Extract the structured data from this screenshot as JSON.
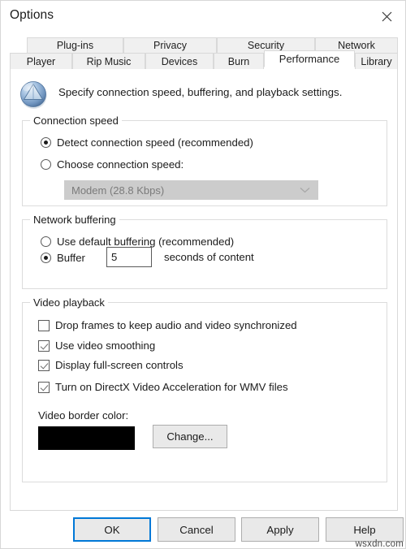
{
  "window": {
    "title": "Options",
    "close_icon": "close-icon"
  },
  "tabs": {
    "top_row": [
      {
        "label": "Plug-ins",
        "active": false
      },
      {
        "label": "Privacy",
        "active": false
      },
      {
        "label": "Security",
        "active": false
      },
      {
        "label": "Network",
        "active": false
      }
    ],
    "bottom_row": [
      {
        "label": "Player",
        "active": false
      },
      {
        "label": "Rip Music",
        "active": false
      },
      {
        "label": "Devices",
        "active": false
      },
      {
        "label": "Burn",
        "active": false
      },
      {
        "label": "Performance",
        "active": true
      },
      {
        "label": "Library",
        "active": false
      }
    ]
  },
  "header": {
    "icon": "media-player-globe-icon",
    "description": "Specify connection speed, buffering, and playback settings."
  },
  "connection_speed": {
    "group_title": "Connection speed",
    "options": [
      {
        "label": "Detect connection speed (recommended)",
        "selected": true
      },
      {
        "label": "Choose connection speed:",
        "selected": false
      }
    ],
    "combo": {
      "value": "Modem (28.8 Kbps)",
      "disabled": true,
      "arrow_icon": "chevron-down-icon"
    }
  },
  "network_buffering": {
    "group_title": "Network buffering",
    "options": [
      {
        "label": "Use default buffering (recommended)",
        "selected": false
      },
      {
        "label": "Buffer",
        "selected": true
      }
    ],
    "buffer_seconds": "5",
    "buffer_suffix": "seconds of content"
  },
  "video_playback": {
    "group_title": "Video playback",
    "checkboxes": [
      {
        "label": "Drop frames to keep audio and video synchronized",
        "checked": false
      },
      {
        "label": "Use video smoothing",
        "checked": true
      },
      {
        "label": "Display full-screen controls",
        "checked": true
      },
      {
        "label": "Turn on DirectX Video Acceleration for WMV files",
        "checked": true
      }
    ],
    "border_color_label": "Video border color:",
    "border_color_value": "#000000",
    "change_button": "Change..."
  },
  "footer": {
    "buttons": [
      {
        "label": "OK",
        "default": true
      },
      {
        "label": "Cancel",
        "default": false
      },
      {
        "label": "Apply",
        "default": false
      },
      {
        "label": "Help",
        "default": false
      }
    ]
  },
  "watermark": "wsxdn.com"
}
